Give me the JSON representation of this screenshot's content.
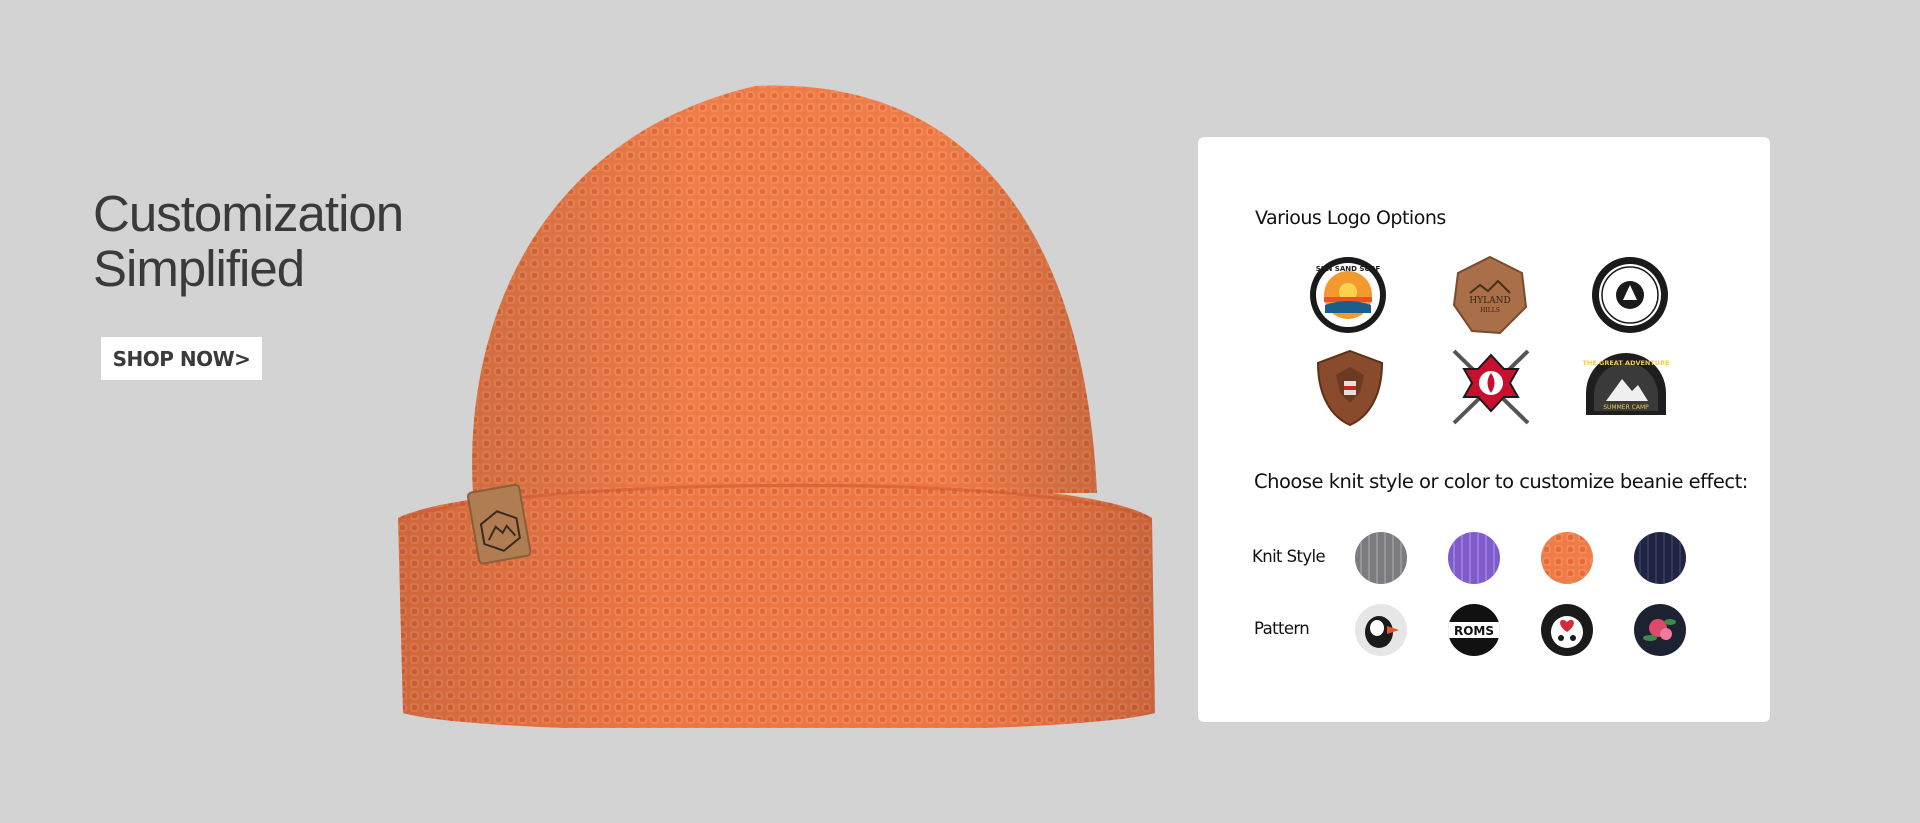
{
  "hero": {
    "title_line1": "Customization",
    "title_line2": "Simplified",
    "shop_button": "SHOP NOW>"
  },
  "product": {
    "image": "orange-waffle-knit-beanie",
    "patch": "leather-mountain-patch"
  },
  "panel": {
    "logos_heading": "Various Logo Options",
    "logo_options": [
      "sun-sand-surf-patch",
      "hyland-hills-leather-patch",
      "black-white-round-patch",
      "eagle-leather-shield-patch",
      "fire-axe-emblem-patch",
      "great-adventure-arch-patch"
    ],
    "customize_heading": "Choose knit style or color to customize beanie effect:",
    "knit_style_label": "Knit Style",
    "pattern_label": "Pattern",
    "knit_styles": [
      "gray",
      "purple",
      "orange",
      "navy"
    ],
    "patterns": [
      "puffin",
      "romsi",
      "floral-white",
      "rose"
    ]
  },
  "colors": {
    "background": "#d3d3d3",
    "beanie": "#ef7a47",
    "panel": "#ffffff",
    "text": "#3a3a3a"
  }
}
